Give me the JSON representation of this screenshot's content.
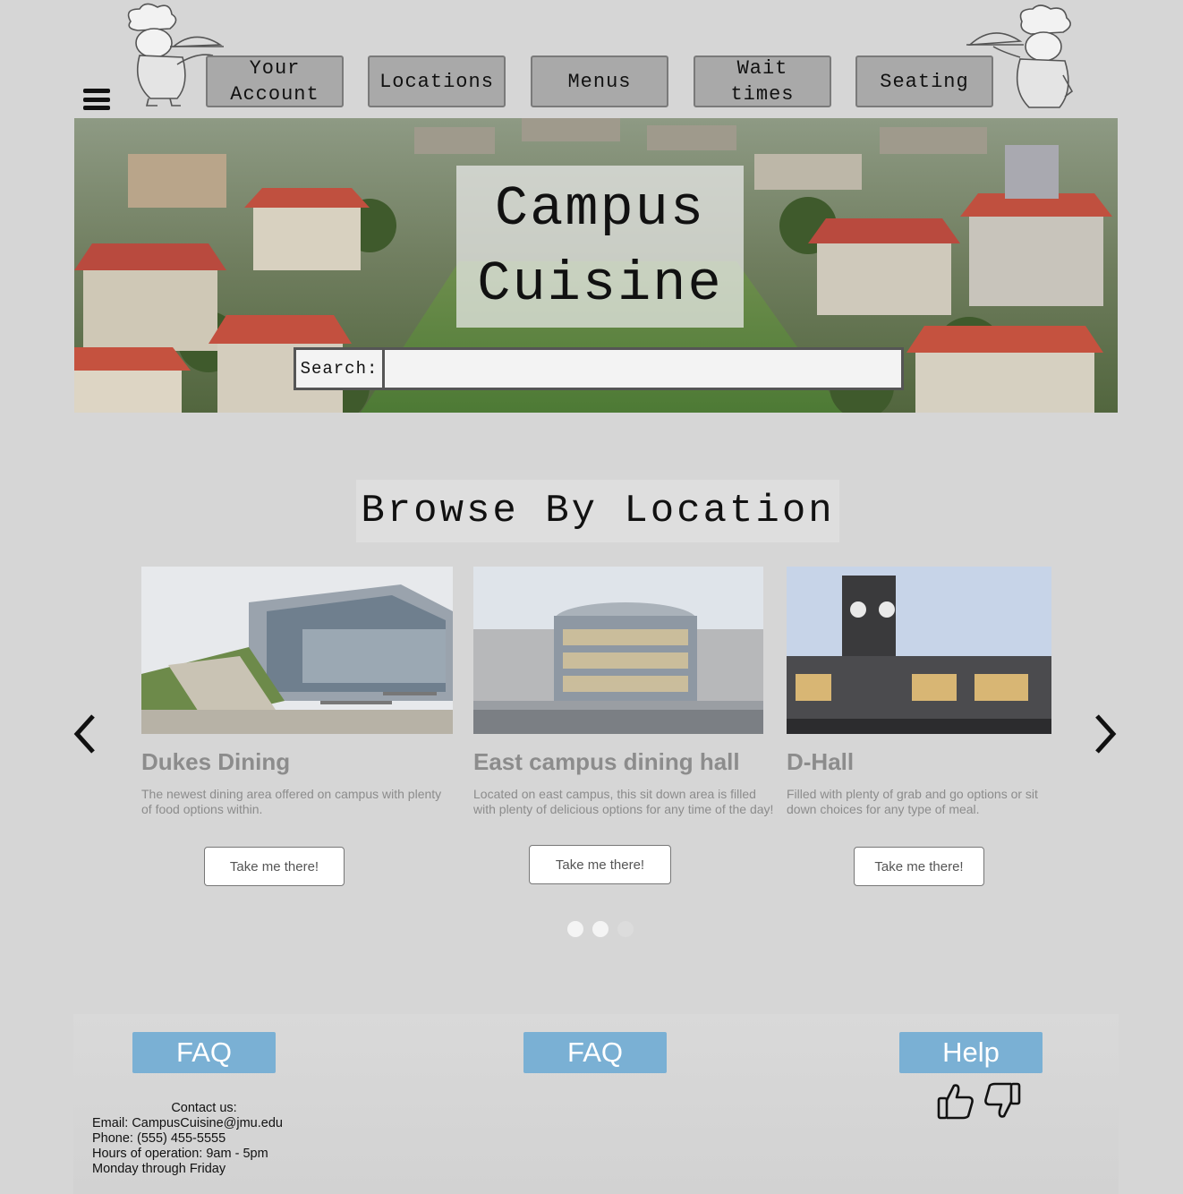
{
  "nav": {
    "menu_icon": "hamburger-menu-icon",
    "buttons": [
      "Your\nAccount",
      "Locations",
      "Menus",
      "Wait\ntimes",
      "Seating"
    ],
    "decor_icon": "chef-waiter-icon"
  },
  "hero": {
    "title": "Campus\nCuisine",
    "search_label": "Search:",
    "search_value": ""
  },
  "browse": {
    "title": "Browse By Location",
    "prev_icon": "chevron-left-icon",
    "next_icon": "chevron-right-icon",
    "cards": [
      {
        "name": "Dukes Dining",
        "description": "The newest dining area offered on campus with plenty of food options within.",
        "button": "Take me there!"
      },
      {
        "name": "East campus dining hall",
        "description": "Located on east campus, this sit down area is filled with plenty of delicious options for any time of the day!",
        "button": "Take me there!"
      },
      {
        "name": "D-Hall",
        "description": "Filled with plenty of grab and go options or sit down choices for any type of meal.",
        "button": "Take me there!"
      }
    ],
    "pager_count": 3,
    "pager_active": [
      0,
      1
    ]
  },
  "footer": {
    "buttons": [
      "FAQ",
      "FAQ",
      "Help"
    ],
    "contact_heading": "Contact us:",
    "contact_lines": [
      "Email: CampusCuisine@jmu.edu",
      "Phone: (555) 455-5555",
      "Hours of operation: 9am - 5pm",
      "Monday through Friday"
    ],
    "feedback_icons": [
      "thumbs-up-icon",
      "thumbs-down-icon"
    ]
  },
  "colors": {
    "page_bg": "#d6d6d6",
    "nav_button_bg": "#a9a9a9",
    "footer_button_bg": "#7ab0d4",
    "card_text": "#8c8c8c"
  }
}
